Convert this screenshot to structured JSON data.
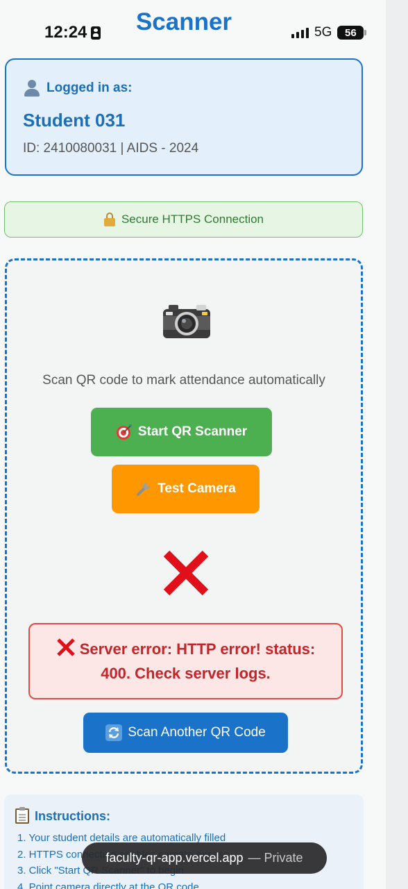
{
  "status_bar": {
    "time": "12:24",
    "network": "5G",
    "battery": "56"
  },
  "header": {
    "title": "Scanner"
  },
  "user": {
    "logged_in_label": "Logged in as:",
    "name": "Student 031",
    "meta": "ID: 2410080031 | AIDS - 2024"
  },
  "connection": {
    "label": "Secure HTTPS Connection"
  },
  "scanner": {
    "description": "Scan QR code to mark attendance automatically",
    "start_label": "Start QR Scanner",
    "test_label": "Test Camera",
    "error_line1": "Server error: HTTP error! status:",
    "error_line2": "400. Check server logs.",
    "scan_another_label": "Scan Another QR Code"
  },
  "instructions": {
    "title": "Instructions:",
    "items": [
      "1.  Your student details are automatically filled",
      "2.  HTTPS connection enables camera access",
      "3.  Click \"Start QR Scanner\" to begin",
      "4.  Point camera directly at the QR code"
    ]
  },
  "url_bar": {
    "url": "faculty-qr-app.vercel.app",
    "mode": "— Private"
  },
  "colors": {
    "accent": "#1a73c8",
    "success": "#4caf50",
    "warning": "#ff9800",
    "error": "#e24b40"
  }
}
